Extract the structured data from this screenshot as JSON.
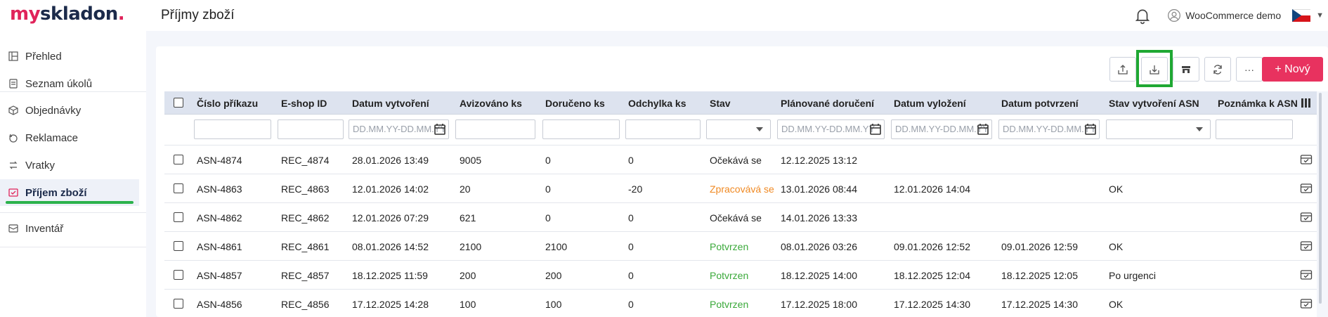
{
  "app": {
    "logo_part1": "my",
    "logo_part2": "skladon",
    "logo_dot": ".",
    "page_title": "Příjmy zboží"
  },
  "header": {
    "user_name": "WooCommerce demo",
    "language": "CZ",
    "notifications_icon": "bell-icon"
  },
  "sidebar": {
    "items": [
      {
        "label": "Přehled",
        "icon": "dashboard-icon"
      },
      {
        "label": "Seznam úkolů",
        "icon": "list-icon"
      },
      {
        "label": "Objednávky",
        "icon": "box-icon"
      },
      {
        "label": "Reklamace",
        "icon": "return-icon"
      },
      {
        "label": "Vratky",
        "icon": "swap-icon"
      },
      {
        "label": "Příjem zboží",
        "icon": "inbox-icon",
        "active": true
      },
      {
        "label": "Inventář",
        "icon": "inventory-icon"
      }
    ]
  },
  "toolbar": {
    "new_label": "+ Nový",
    "more_label": "···"
  },
  "table": {
    "columns": [
      "Číslo příkazu",
      "E-shop ID",
      "Datum vytvoření",
      "Avizováno ks",
      "Doručeno ks",
      "Odchylka ks",
      "Stav",
      "Plánované doručení",
      "Datum vyložení",
      "Datum potvrzení",
      "Stav vytvoření ASN",
      "Poznámka k ASN"
    ],
    "date_placeholder": "DD.MM.YY-DD.MM.YY",
    "rows": [
      {
        "order": "ASN-4874",
        "eshop": "REC_4874",
        "created": "28.01.2026 13:49",
        "advised": "9005",
        "delivered": "0",
        "diff": "0",
        "status": "Očekává se",
        "status_type": "wait",
        "planned": "12.12.2025 13:12",
        "unloaded": "",
        "confirmed": "",
        "asn_state": "",
        "note": ""
      },
      {
        "order": "ASN-4863",
        "eshop": "REC_4863",
        "created": "12.01.2026 14:02",
        "advised": "20",
        "delivered": "0",
        "diff": "-20",
        "status": "Zpracovává se",
        "status_type": "proc",
        "planned": "13.01.2026 08:44",
        "unloaded": "12.01.2026 14:04",
        "confirmed": "",
        "asn_state": "OK",
        "note": ""
      },
      {
        "order": "ASN-4862",
        "eshop": "REC_4862",
        "created": "12.01.2026 07:29",
        "advised": "621",
        "delivered": "0",
        "diff": "0",
        "status": "Očekává se",
        "status_type": "wait",
        "planned": "14.01.2026 13:33",
        "unloaded": "",
        "confirmed": "",
        "asn_state": "",
        "note": ""
      },
      {
        "order": "ASN-4861",
        "eshop": "REC_4861",
        "created": "08.01.2026 14:52",
        "advised": "2100",
        "delivered": "2100",
        "diff": "0",
        "status": "Potvrzen",
        "status_type": "ok",
        "planned": "08.01.2026 03:26",
        "unloaded": "09.01.2026 12:52",
        "confirmed": "09.01.2026 12:59",
        "asn_state": "OK",
        "note": ""
      },
      {
        "order": "ASN-4857",
        "eshop": "REC_4857",
        "created": "18.12.2025 11:59",
        "advised": "200",
        "delivered": "200",
        "diff": "0",
        "status": "Potvrzen",
        "status_type": "ok",
        "planned": "18.12.2025 14:00",
        "unloaded": "18.12.2025 12:04",
        "confirmed": "18.12.2025 12:05",
        "asn_state": "Po urgenci",
        "note": ""
      },
      {
        "order": "ASN-4856",
        "eshop": "REC_4856",
        "created": "17.12.2025 14:28",
        "advised": "100",
        "delivered": "100",
        "diff": "0",
        "status": "Potvrzen",
        "status_type": "ok",
        "planned": "17.12.2025 18:00",
        "unloaded": "17.12.2025 14:30",
        "confirmed": "17.12.2025 14:30",
        "asn_state": "OK",
        "note": ""
      }
    ]
  },
  "colors": {
    "brand": "#e0235a",
    "accent_green": "#1fa833",
    "status_processing": "#f08a24",
    "status_confirmed": "#3aa93a"
  }
}
